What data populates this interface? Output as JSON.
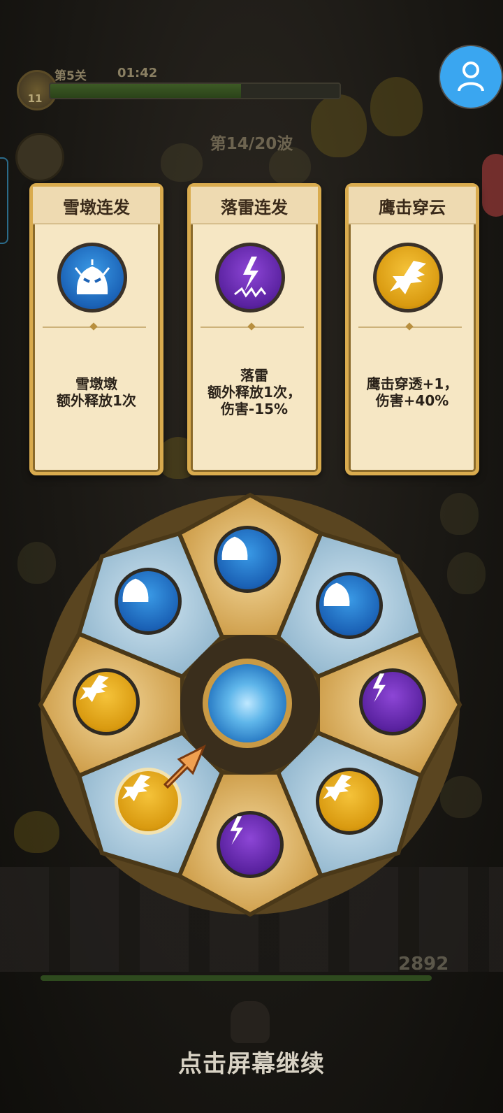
{
  "hud": {
    "level_badge": "11",
    "stage": "第5关",
    "timer": "01:42",
    "progress": 0.66,
    "wave": "第14/20波",
    "hp_value": "2892"
  },
  "cards": [
    {
      "title": "雪墩连发",
      "icon": "snow-ghost-icon",
      "orb_color": "#1b62b6",
      "desc": [
        "雪墩墩",
        "额外释放1次"
      ]
    },
    {
      "title": "落雷连发",
      "icon": "lightning-icon",
      "orb_color": "#5a22a0",
      "desc": [
        "落雷",
        "额外释放1次，",
        "伤害-15%"
      ]
    },
    {
      "title": "鹰击穿云",
      "icon": "eagle-icon",
      "orb_color": "#d99a10",
      "desc": [
        "鹰击穿透+1，",
        "伤害+40%"
      ]
    }
  ],
  "wheel": {
    "segments": [
      "snow-ghost-icon",
      "snow-ghost-icon",
      "lightning-icon",
      "eagle-icon",
      "lightning-icon",
      "eagle-icon",
      "eagle-icon",
      "snow-ghost-icon"
    ],
    "selected": "eagle-icon"
  },
  "continue_label": "点击屏幕继续",
  "colors": {
    "avatar_button": "#3aa6f0",
    "card_border": "#d9ab4e",
    "card_bg": "#f6e7c4"
  }
}
